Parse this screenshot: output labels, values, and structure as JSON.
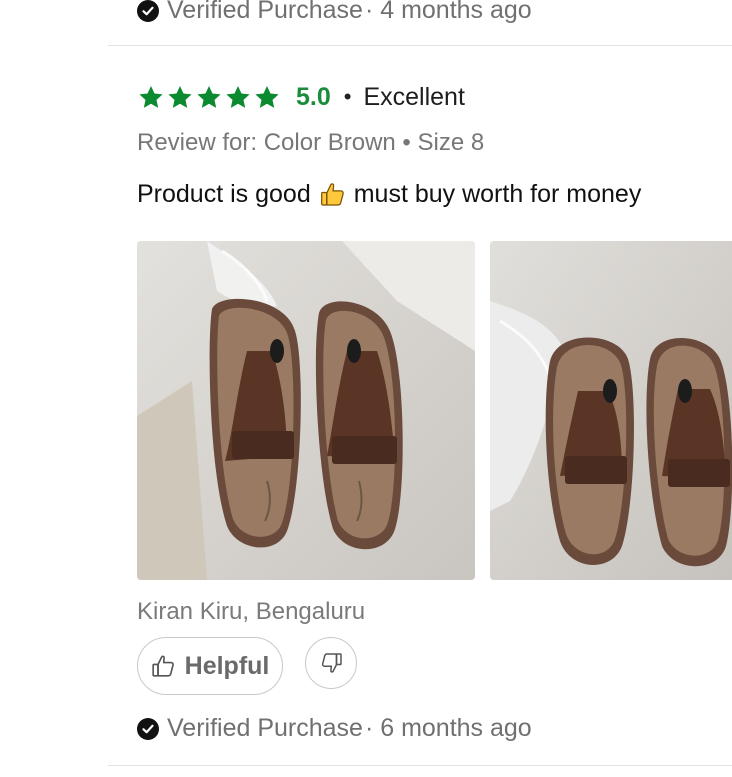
{
  "previous_review": {
    "verified_label": "Verified Purchase",
    "time_ago": "· 4 months ago"
  },
  "review": {
    "rating_stars": 5,
    "rating_score": "5.0",
    "rating_separator": "•",
    "rating_label": "Excellent",
    "variant": "Review for: Color Brown • Size 8",
    "body_before_emoji": "Product is good",
    "body_after_emoji": "must buy worth for money",
    "emoji": "thumbs-up-emoji",
    "photos": [
      {
        "icon": "sandal-photo"
      },
      {
        "icon": "sandal-photo"
      }
    ],
    "reviewer": "Kiran Kiru, Bengaluru",
    "helpful_label": "Helpful",
    "verified_label": "Verified Purchase",
    "time_ago": "· 6 months ago"
  },
  "colors": {
    "star_green": "#0b8a2f",
    "score_green": "#1a8d3d",
    "muted_text": "#777777",
    "divider": "#e3e3e3"
  }
}
